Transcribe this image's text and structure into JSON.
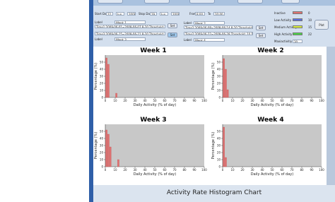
{
  "controls": {
    "start_day_label": "Start Day",
    "start_day_value": "22",
    "start_month_value": "Jun",
    "start_year_value": "2009",
    "stop_day_label": "Stop Day",
    "stop_day_value": "29",
    "stop_month_value": "Jun",
    "stop_year_value": "2009",
    "from_label": "From",
    "from_value": "8:00",
    "to_label": "To",
    "to_value": "20:00",
    "set_label": "Set",
    "plot_label": "Plot",
    "label_caption": "Label",
    "week_fields": [
      {
        "label_value": "Week 1",
        "time_text": "Time1:2009-06-01~2009-06-07 8-20 Threshold: 10 15 22"
      },
      {
        "label_value": "Week 2",
        "time_text": "Time2:2009-06-08~2009-06-14 8-20 Threshold: 10 15 22"
      },
      {
        "label_value": "Week 3",
        "time_text": "Time3:2009-06-15~2009-06-21 8-20 Threshold: 10 15 22"
      },
      {
        "label_value": "Week 4",
        "time_text": "Time2:2009-06-22~2009-06-28 Threshold: 10 15 22"
      }
    ]
  },
  "legend": [
    {
      "label": "Inactive",
      "color": "#e07272",
      "value": "0"
    },
    {
      "label": "Low Activity",
      "color": "#5a6ee0",
      "value": "10"
    },
    {
      "label": "Medium Activity",
      "color": "#d8ec3c",
      "value": "15"
    },
    {
      "label": "High Activity",
      "color": "#49d649",
      "value": "22"
    },
    {
      "label": "Maxiactivitiy",
      "color": "",
      "value": "30"
    }
  ],
  "footer_title": "Activity Rate Histogram Chart",
  "chart_data": [
    {
      "type": "bar",
      "title": "Week 1",
      "xlabel": "Daily Activity (% of day)",
      "ylabel": "Percentage (%)",
      "xlim": [
        0,
        100
      ],
      "ylim": [
        0,
        60
      ],
      "xticks": [
        0,
        10,
        20,
        30,
        40,
        50,
        60,
        70,
        80,
        90,
        100
      ],
      "yticks": [
        0,
        10,
        20,
        30,
        40,
        50
      ],
      "x": [
        0,
        2,
        10
      ],
      "values": [
        56,
        47,
        6
      ]
    },
    {
      "type": "bar",
      "title": "Week 2",
      "xlabel": "Daily Activity (% of day)",
      "ylabel": "Percentage (%)",
      "xlim": [
        0,
        100
      ],
      "ylim": [
        0,
        60
      ],
      "xticks": [
        0,
        10,
        20,
        30,
        40,
        50,
        60,
        70,
        80,
        90,
        100
      ],
      "yticks": [
        0,
        10,
        20,
        30,
        40,
        50
      ],
      "x": [
        0,
        2,
        4
      ],
      "values": [
        55,
        40,
        11
      ]
    },
    {
      "type": "bar",
      "title": "Week 3",
      "xlabel": "Daily Activity (% of day)",
      "ylabel": "Percentage (%)",
      "xlim": [
        0,
        100
      ],
      "ylim": [
        0,
        60
      ],
      "xticks": [
        0,
        10,
        20,
        30,
        40,
        50,
        60,
        70,
        80,
        90,
        100
      ],
      "yticks": [
        0,
        10,
        20,
        30,
        40,
        50
      ],
      "x": [
        0,
        2,
        4,
        12
      ],
      "values": [
        52,
        46,
        28,
        10
      ]
    },
    {
      "type": "bar",
      "title": "Week 4",
      "xlabel": "Daily Activity (% of day)",
      "ylabel": "Percentage (%)",
      "xlim": [
        0,
        100
      ],
      "ylim": [
        0,
        60
      ],
      "xticks": [
        0,
        10,
        20,
        30,
        40,
        50,
        60,
        70,
        80,
        90,
        100
      ],
      "yticks": [
        0,
        10,
        20,
        30,
        40,
        50
      ],
      "x": [
        0,
        2
      ],
      "values": [
        56,
        13
      ]
    }
  ]
}
